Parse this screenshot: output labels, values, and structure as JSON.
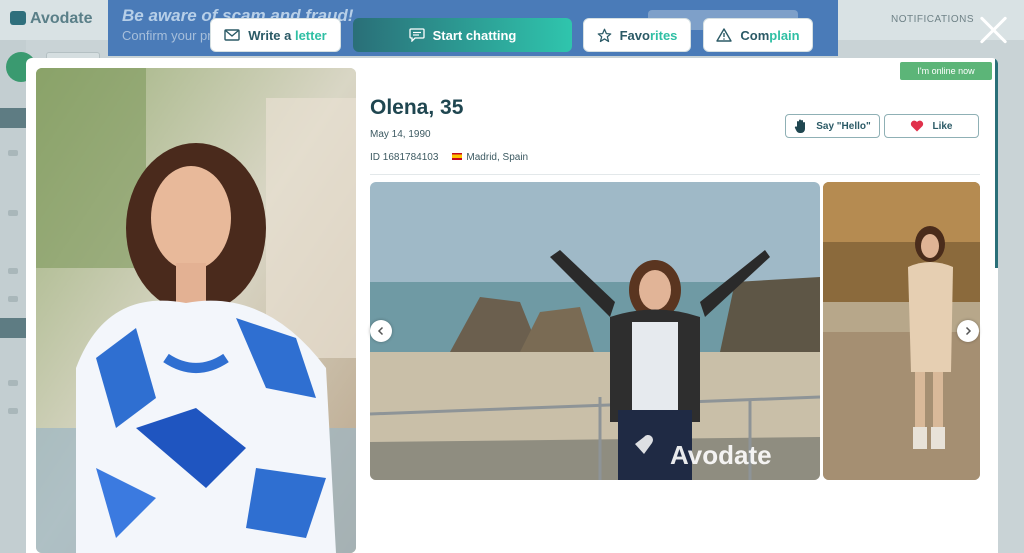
{
  "background": {
    "logo": "Avodate",
    "banner_line1": "Be aware of scam and fraud!",
    "banner_line2": "Confirm your profile",
    "notifications": "NOTIFICATIONS"
  },
  "actions": {
    "write_letter": {
      "pre": "Write a ",
      "hl": "letter",
      "icon": "envelope-icon"
    },
    "start_chatting": {
      "label": "Start chatting",
      "icon": "chat-icon"
    },
    "favorites": {
      "pre": "Favo",
      "hl": "rites",
      "icon": "star-icon"
    },
    "complain": {
      "pre": "Com",
      "hl": "plain",
      "icon": "warning-icon"
    },
    "close_icon": "close-icon"
  },
  "profile": {
    "online_status": "I'm online now",
    "name_age": "Olena, 35",
    "birth_date": "May 14, 1990",
    "id_text": "ID 1681784103",
    "location": "Madrid, Spain",
    "say_hello": "Say \"Hello\"",
    "like": "Like"
  },
  "gallery": {
    "watermark": "Avodate"
  },
  "colors": {
    "accent": "#2fc5ad",
    "primary_dark": "#2a6f78",
    "online_green": "#5cb578",
    "like_red": "#e0314b"
  }
}
